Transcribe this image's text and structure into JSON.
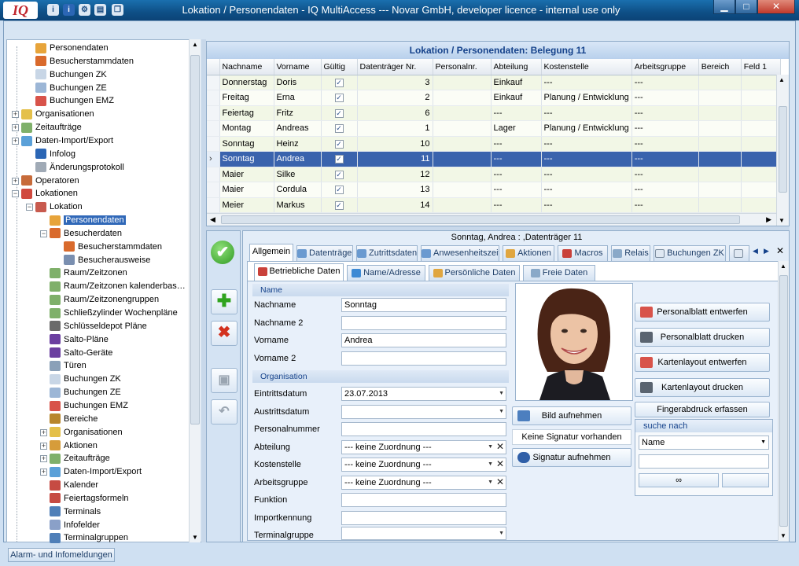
{
  "window": {
    "logo": "IQ",
    "title": "Lokation / Personendaten - IQ MultiAccess --- Novar GmbH, developer licence - internal use only",
    "toolbar_icons": [
      "info-icon",
      "info-icon",
      "settings-icon",
      "document-icon",
      "copy-icon"
    ],
    "controls": [
      "minimize",
      "maximize",
      "close"
    ]
  },
  "tree": {
    "items": [
      {
        "label": "Personendaten",
        "icon": "person-icon"
      },
      {
        "label": "Besucherstammdaten",
        "icon": "visitor-icon"
      },
      {
        "label": "Buchungen ZK",
        "icon": "document-icon"
      },
      {
        "label": "Buchungen ZE",
        "icon": "clock-document-icon"
      },
      {
        "label": "Buchungen EMZ",
        "icon": "document-red-icon"
      },
      {
        "label": "Organisationen",
        "icon": "folder-icon"
      },
      {
        "label": "Zeitaufträge",
        "icon": "clock-icon"
      },
      {
        "label": "Daten-Import/Export",
        "icon": "import-icon"
      },
      {
        "label": "Infolog",
        "icon": "info-icon"
      },
      {
        "label": "Änderungsprotokoll",
        "icon": "users-icon"
      },
      {
        "label": "Operatoren",
        "icon": "operators-icon"
      },
      {
        "label": "Lokationen",
        "icon": "locations-icon"
      },
      {
        "label": "Lokation",
        "icon": "location-icon"
      },
      {
        "label": "Personendaten",
        "icon": "person-icon"
      },
      {
        "label": "Besucherdaten",
        "icon": "visitor-icon"
      },
      {
        "label": "Besucherstammdaten",
        "icon": "visitor-icon"
      },
      {
        "label": "Besucherausweise",
        "icon": "card-icon"
      },
      {
        "label": "Raum/Zeitzonen",
        "icon": "clock-icon"
      },
      {
        "label": "Raum/Zeitzonen kalenderbas…",
        "icon": "clock-icon"
      },
      {
        "label": "Raum/Zeitzonengruppen",
        "icon": "clock-icon"
      },
      {
        "label": "Schließzylinder Wochenpläne",
        "icon": "clock-icon"
      },
      {
        "label": "Schlüsseldepot Pläne",
        "icon": "key-icon"
      },
      {
        "label": "Salto-Pläne",
        "icon": "salto-icon"
      },
      {
        "label": "Salto-Geräte",
        "icon": "salto-icon"
      },
      {
        "label": "Türen",
        "icon": "door-icon"
      },
      {
        "label": "Buchungen ZK",
        "icon": "document-icon"
      },
      {
        "label": "Buchungen ZE",
        "icon": "clock-document-icon"
      },
      {
        "label": "Buchungen EMZ",
        "icon": "document-red-icon"
      },
      {
        "label": "Bereiche",
        "icon": "area-icon"
      },
      {
        "label": "Organisationen",
        "icon": "folder-icon"
      },
      {
        "label": "Aktionen",
        "icon": "actions-icon"
      },
      {
        "label": "Zeitaufträge",
        "icon": "clock-icon"
      },
      {
        "label": "Daten-Import/Export",
        "icon": "import-icon"
      },
      {
        "label": "Kalender",
        "icon": "calendar-icon"
      },
      {
        "label": "Feiertagsformeln",
        "icon": "calendar-icon"
      },
      {
        "label": "Terminals",
        "icon": "terminal-icon"
      },
      {
        "label": "Infofelder",
        "icon": "speech-icon"
      },
      {
        "label": "Terminalgruppen",
        "icon": "terminal-group-icon"
      }
    ]
  },
  "grid": {
    "title": "Lokation / Personendaten: Belegung 11",
    "columns": [
      "Nachname",
      "Vorname",
      "Gültig",
      "Datenträger Nr.",
      "Personalnr.",
      "Abteilung",
      "Kostenstelle",
      "Arbeitsgruppe",
      "Bereich",
      "Feld 1"
    ],
    "rows": [
      {
        "nachname": "Donnerstag",
        "vorname": "Doris",
        "nr": "3",
        "abteilung": "Einkauf",
        "kostenstelle": "---",
        "arbeitsgruppe": "---"
      },
      {
        "nachname": "Freitag",
        "vorname": "Erna",
        "nr": "2",
        "abteilung": "Einkauf",
        "kostenstelle": "Planung / Entwicklung",
        "arbeitsgruppe": "---"
      },
      {
        "nachname": "Feiertag",
        "vorname": "Fritz",
        "nr": "6",
        "abteilung": "---",
        "kostenstelle": "---",
        "arbeitsgruppe": "---"
      },
      {
        "nachname": "Montag",
        "vorname": "Andreas",
        "nr": "1",
        "abteilung": "Lager",
        "kostenstelle": "Planung / Entwicklung",
        "arbeitsgruppe": "---"
      },
      {
        "nachname": "Sonntag",
        "vorname": "Heinz",
        "nr": "10",
        "abteilung": "---",
        "kostenstelle": "---",
        "arbeitsgruppe": "---"
      },
      {
        "nachname": "Sonntag",
        "vorname": "Andrea",
        "nr": "11",
        "abteilung": "---",
        "kostenstelle": "---",
        "arbeitsgruppe": "---",
        "selected": true
      },
      {
        "nachname": "Maier",
        "vorname": "Silke",
        "nr": "12",
        "abteilung": "---",
        "kostenstelle": "---",
        "arbeitsgruppe": "---"
      },
      {
        "nachname": "Maier",
        "vorname": "Cordula",
        "nr": "13",
        "abteilung": "---",
        "kostenstelle": "---",
        "arbeitsgruppe": "---"
      },
      {
        "nachname": "Meier",
        "vorname": "Markus",
        "nr": "14",
        "abteilung": "---",
        "kostenstelle": "---",
        "arbeitsgruppe": "---"
      }
    ]
  },
  "detail": {
    "header": "Sonntag, Andrea : ,Datenträger 11",
    "tabs": [
      "Allgemein",
      "Datenträger",
      "Zutrittsdaten",
      "Anwesenheitszeit",
      "Aktionen",
      "Macros",
      "Relais",
      "Buchungen ZK"
    ],
    "subtabs": [
      "Betriebliche Daten",
      "Name/Adresse",
      "Persönliche Daten",
      "Freie Daten"
    ],
    "sections": {
      "name": "Name",
      "organisation": "Organisation"
    },
    "fields": {
      "nachname": {
        "label": "Nachname",
        "value": "Sonntag"
      },
      "nachname2": {
        "label": "Nachname 2",
        "value": ""
      },
      "vorname": {
        "label": "Vorname",
        "value": "Andrea"
      },
      "vorname2": {
        "label": "Vorname 2",
        "value": ""
      },
      "eintrittsdatum": {
        "label": "Eintrittsdatum",
        "value": "23.07.2013"
      },
      "austrittsdatum": {
        "label": "Austrittsdatum",
        "value": ""
      },
      "personalnummer": {
        "label": "Personalnummer",
        "value": ""
      },
      "abteilung": {
        "label": "Abteilung",
        "value": "--- keine Zuordnung ---"
      },
      "kostenstelle": {
        "label": "Kostenstelle",
        "value": "--- keine Zuordnung ---"
      },
      "arbeitsgruppe": {
        "label": "Arbeitsgruppe",
        "value": "--- keine Zuordnung ---"
      },
      "funktion": {
        "label": "Funktion",
        "value": ""
      },
      "importkennung": {
        "label": "Importkennung",
        "value": ""
      },
      "terminalgruppe": {
        "label": "Terminalgruppe",
        "value": ""
      }
    },
    "buttons": {
      "bild": "Bild aufnehmen",
      "signatur_status": "Keine Signatur vorhanden",
      "signatur": "Signatur aufnehmen",
      "personalblatt_entwerfen": "Personalblatt entwerfen",
      "personalblatt_drucken": "Personalblatt drucken",
      "kartenlayout_entwerfen": "Kartenlayout entwerfen",
      "kartenlayout_drucken": "Kartenlayout drucken",
      "fingerabdruck": "Fingerabdruck erfassen"
    },
    "search": {
      "label": "suche nach",
      "select": "Name",
      "query": ""
    }
  },
  "statusbar": {
    "tab": "Alarm- und Infomeldungen"
  },
  "colors": {
    "titlebar": "#0e4f86",
    "selection": "#3a63ad",
    "row_alt": "#f2f7e6",
    "accent_text": "#15428b"
  }
}
